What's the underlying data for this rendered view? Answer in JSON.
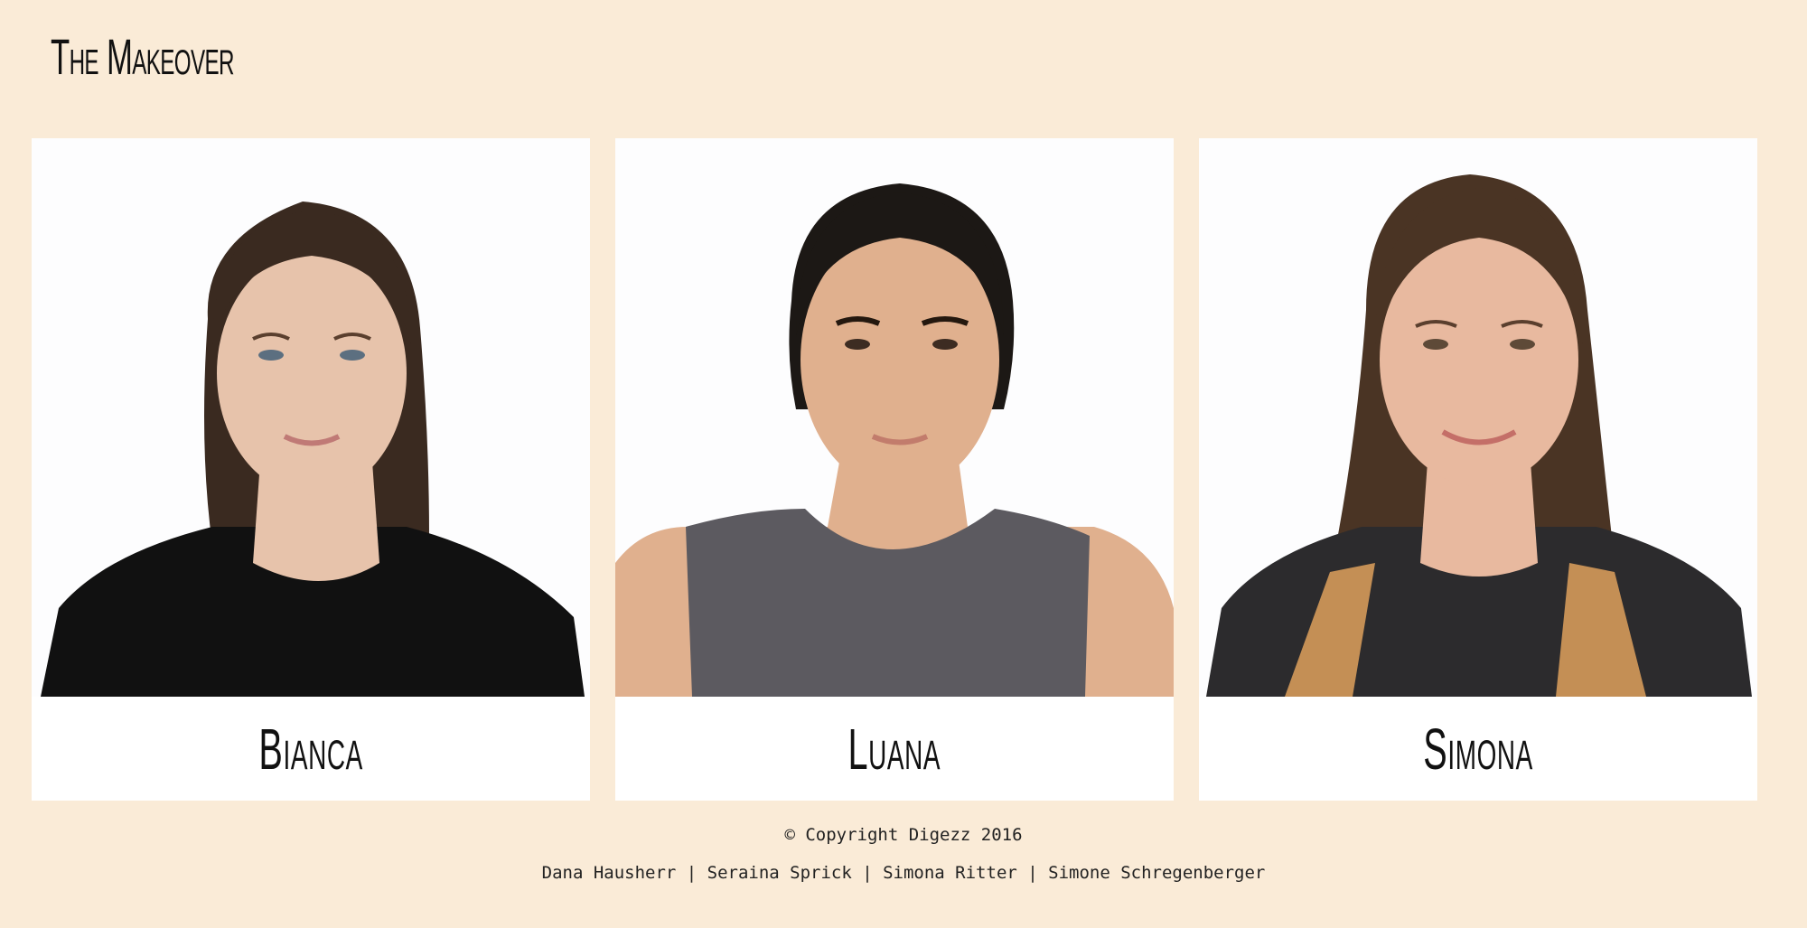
{
  "header": {
    "title": "The Makeover"
  },
  "gallery": {
    "people": [
      {
        "name": "Bianca",
        "hair_color": "#3a2a20",
        "hair_tips": "#6b4a30",
        "skin": "#e7c3ab",
        "shirt": "#111111",
        "photo_icon": "portrait-icon"
      },
      {
        "name": "Luana",
        "hair_color": "#1c1815",
        "hair_tips": "#1c1815",
        "skin": "#e0b08e",
        "shirt": "#5c5a60",
        "photo_icon": "portrait-icon"
      },
      {
        "name": "Simona",
        "hair_color": "#4a3424",
        "hair_tips": "#c48f55",
        "skin": "#e8b99f",
        "shirt": "#2c2b2d",
        "photo_icon": "portrait-icon"
      }
    ]
  },
  "footer": {
    "copyright": "© Copyright Digezz 2016",
    "credits": "Dana Hausherr | Seraina Sprick | Simona Ritter | Simone Schregenberger"
  },
  "colors": {
    "page_background": "#faebd7",
    "card_background": "#ffffff",
    "text": "#111111"
  }
}
